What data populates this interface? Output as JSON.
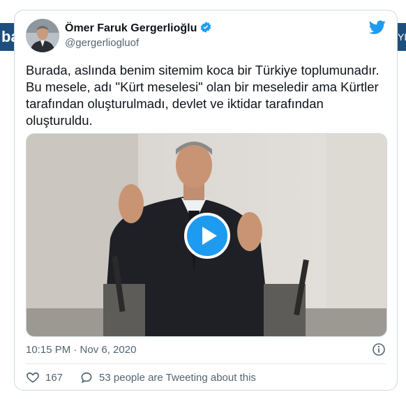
{
  "background": {
    "left_fragment": "ba",
    "right_fragment": "YL"
  },
  "author": {
    "name": "Ömer Faruk Gergerlioğlu",
    "handle": "@gergerliogluof",
    "verified": true
  },
  "tweet": {
    "text": "Burada, aslında benim sitemim koca bir Türkiye toplumunadır. Bu mesele, adı \"Kürt meselesi\" olan bir meseledir ama Kürtler tarafından oluşturulmadı, devlet ve iktidar tarafından oluşturuldu.",
    "timestamp": "10:15 PM · Nov 6, 2020",
    "likes": "167",
    "tweeting_text": "53 people are Tweeting about this"
  },
  "icons": {
    "logo": "twitter-bird-icon",
    "verified": "verified-badge-icon",
    "play": "play-icon",
    "info": "info-icon",
    "like": "heart-icon",
    "reply": "speech-bubble-icon"
  },
  "colors": {
    "twitter_blue": "#1d9bf0",
    "text": "#0f1419",
    "secondary": "#536471",
    "border": "#cfd9de"
  }
}
